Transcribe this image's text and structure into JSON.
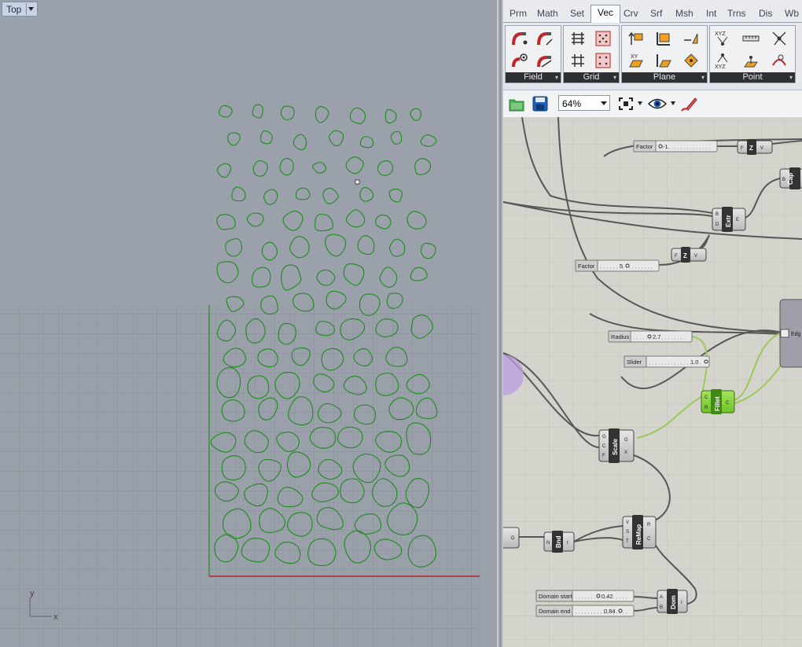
{
  "viewport": {
    "name": "Top",
    "axis_x": "x",
    "axis_y": "y"
  },
  "ribbon": {
    "tabs": [
      "Prm",
      "Math",
      "Set",
      "Vec",
      "Crv",
      "Srf",
      "Msh",
      "Int",
      "Trns",
      "Dis",
      "Wb"
    ],
    "active_tab": "Vec",
    "groups": [
      "Field",
      "Grid",
      "Plane",
      "Point"
    ]
  },
  "toolbar": {
    "zoom": "64%"
  },
  "sliders": {
    "factor1": {
      "label": "Factor",
      "value": "-1"
    },
    "factor2": {
      "label": "Factor",
      "value": "5"
    },
    "radius": {
      "label": "Radius",
      "value": "2.7"
    },
    "slider": {
      "label": "Slider",
      "value": "1.0"
    },
    "domain_start": {
      "label": "Domain start",
      "value": "0.42"
    },
    "domain_end": {
      "label": "Domain end",
      "value": "0.84"
    }
  },
  "components": {
    "z1": {
      "title": "Z",
      "in": "F",
      "out": "V"
    },
    "z2": {
      "title": "Z",
      "in": "F",
      "out": "V"
    },
    "extr": {
      "title": "Extr",
      "in1": "B",
      "in2": "D",
      "out": "E"
    },
    "cap": {
      "title": "Cap",
      "in": "B"
    },
    "edges": {
      "title": "Edg"
    },
    "fillet": {
      "title": "Fillet",
      "in1": "C",
      "in2": "R",
      "out": "C"
    },
    "scale": {
      "title": "Scale",
      "in1": "G",
      "in2": "C",
      "in3": "F",
      "out1": "G",
      "out2": "X"
    },
    "bnd": {
      "title": "Bnd",
      "in": "N",
      "out": "I"
    },
    "remap": {
      "title": "ReMap",
      "in1": "V",
      "in2": "S",
      "in3": "T",
      "out1": "R",
      "out2": "C"
    },
    "dom": {
      "title": "Dom",
      "in1": "A",
      "in2": "B",
      "out": "I"
    },
    "left_d": {
      "out": "D"
    }
  },
  "colors": {
    "viewport_bg": "#9ba1aa",
    "curve_green": "#1f8a1f",
    "axis_red": "#b3262b",
    "canvas_bg": "#d5d4cc",
    "component_selected": "#86d43a"
  }
}
